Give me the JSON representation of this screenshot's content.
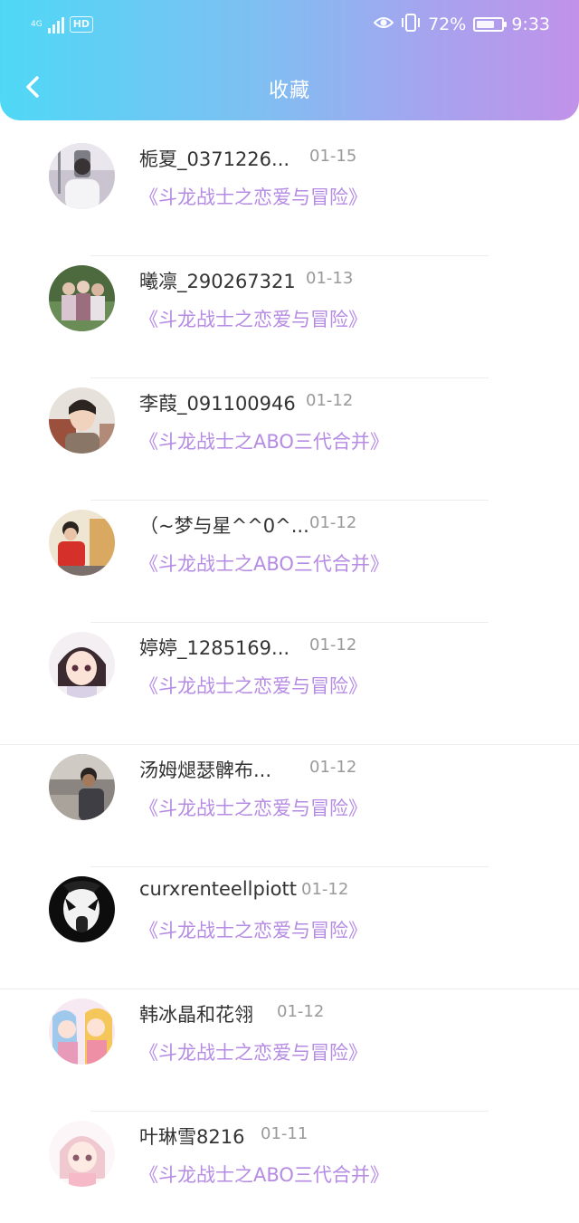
{
  "status_bar": {
    "network": "4G",
    "hd": "HD",
    "battery": "72%",
    "time": "9:33"
  },
  "navbar": {
    "title": "收藏"
  },
  "colors": {
    "accent": "#b68be3",
    "header_start": "#4fd8f6",
    "header_end": "#c192e9"
  },
  "items": [
    {
      "username": "栀夏_0371226...",
      "date": "01-15",
      "title": "《斗龙战士之恋爱与冒险》"
    },
    {
      "username": "曦凛_290267321",
      "date": "01-13",
      "title": "《斗龙战士之恋爱与冒险》"
    },
    {
      "username": "李葭_091100946",
      "date": "01-12",
      "title": "《斗龙战士之ABO三代合并》"
    },
    {
      "username": "（~梦与星^^0^...",
      "date": "01-12",
      "title": "《斗龙战士之ABO三代合并》"
    },
    {
      "username": "婷婷_1285169...",
      "date": "01-12",
      "title": "《斗龙战士之恋爱与冒险》"
    },
    {
      "username": "汤姆煺瑟髀布...",
      "date": "01-12",
      "title": "《斗龙战士之恋爱与冒险》"
    },
    {
      "username": "curxrenteellpiott",
      "date": "01-12",
      "title": "《斗龙战士之恋爱与冒险》"
    },
    {
      "username": "韩冰晶和花翎",
      "date": "01-12",
      "title": "《斗龙战士之恋爱与冒险》"
    },
    {
      "username": "叶琳雪8216",
      "date": "01-11",
      "title": "《斗龙战士之ABO三代合并》"
    }
  ]
}
